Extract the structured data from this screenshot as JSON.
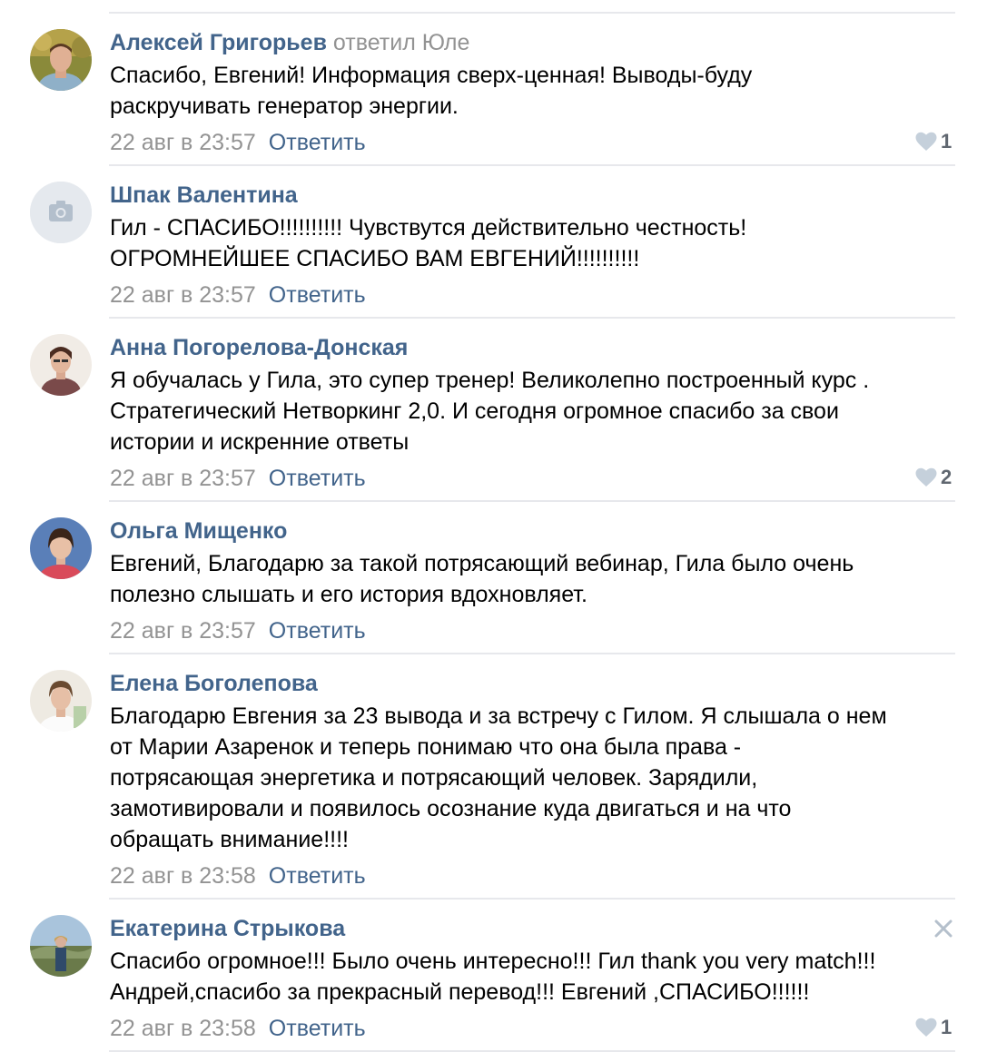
{
  "comments": [
    {
      "author": "Алексей Григорьев",
      "reply_to": "ответил Юле",
      "lines": [
        "Спасибо, Евгений! Информация сверх-ценная! Выводы-буду",
        "раскручивать генератор энергии."
      ],
      "date": "22 авг в 23:57",
      "reply_label": "Ответить",
      "likes": "1",
      "avatar": "photo-man-outdoor"
    },
    {
      "author": "Шпак Валентина",
      "reply_to": "",
      "lines": [
        "Гил - СПАСИБО!!!!!!!!!! Чувствутся действительно честность!",
        "ОГРОМНЕЙШЕЕ СПАСИБО ВАМ ЕВГЕНИЙ!!!!!!!!!!"
      ],
      "date": "22 авг в 23:57",
      "reply_label": "Ответить",
      "likes": "",
      "avatar": "camera-placeholder-icon"
    },
    {
      "author": "Анна Погорелова-Донская",
      "reply_to": "",
      "lines": [
        "Я обучалась у Гила, это супер тренер! Великолепно построенный курс .",
        "Стратегический Нетворкинг 2,0. И сегодня огромное спасибо за свои",
        "истории и искренние ответы"
      ],
      "date": "22 авг в 23:57",
      "reply_label": "Ответить",
      "likes": "2",
      "avatar": "photo-woman-glasses"
    },
    {
      "author": "Ольга Мищенко",
      "reply_to": "",
      "lines": [
        "Евгений, Благодарю за такой потрясающий вебинар, Гила было очень",
        "полезно слышать и его история вдохновляет."
      ],
      "date": "22 авг в 23:57",
      "reply_label": "Ответить",
      "likes": "",
      "avatar": "photo-woman-blue"
    },
    {
      "author": "Елена Боголепова",
      "reply_to": "",
      "lines": [
        "Благодарю Евгения за 23 вывода и за встречу с Гилом. Я слышала о нем",
        "от Марии Азаренок и теперь понимаю что она была права -",
        "потрясающая энергетика и потрясающий человек. Зарядили,",
        "замотивировали и появилось осознание куда двигаться и на что",
        "обращать внимание!!!!"
      ],
      "date": "22 авг в 23:58",
      "reply_label": "Ответить",
      "likes": "",
      "avatar": "photo-woman-white"
    },
    {
      "author": "Екатерина Стрыкова",
      "reply_to": "",
      "lines": [
        "Спасибо огромное!!! Было очень интересно!!! Гил thank you very match!!!",
        "Андрей,спасибо за прекрасный перевод!!! Евгений ,СПАСИБО!!!!!!"
      ],
      "date": "22 авг в 23:58",
      "reply_label": "Ответить",
      "likes": "1",
      "avatar": "photo-woman-landscape"
    }
  ],
  "colors": {
    "link": "#42648b",
    "muted": "#939393",
    "separator": "#e7e8ec",
    "heart": "#c5d0db"
  },
  "icons": {
    "like": "heart-icon",
    "close": "close-icon"
  }
}
